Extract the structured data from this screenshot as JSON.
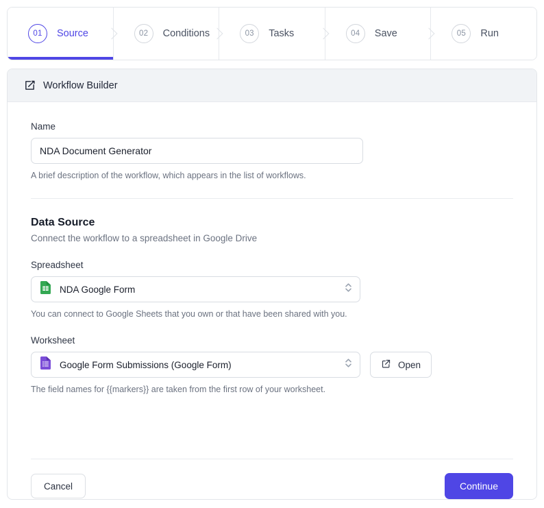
{
  "theme": {
    "accent": "#4f46e5",
    "header_bg": "#f1f3f6",
    "border": "#e3e6ea",
    "text": "#1f2536",
    "muted": "#6b7280",
    "sheets_green": "#34a853",
    "forms_purple": "#7248b9"
  },
  "stepper": {
    "steps": [
      {
        "number": "01",
        "label": "Source",
        "active": true
      },
      {
        "number": "02",
        "label": "Conditions",
        "active": false
      },
      {
        "number": "03",
        "label": "Tasks",
        "active": false
      },
      {
        "number": "04",
        "label": "Save",
        "active": false
      },
      {
        "number": "05",
        "label": "Run",
        "active": false
      }
    ]
  },
  "card": {
    "header": {
      "icon": "edit-square-icon",
      "title": "Workflow Builder"
    },
    "name_field": {
      "label": "Name",
      "value": "NDA Document Generator",
      "placeholder": "NDA Document Generator",
      "hint": "A brief description of the workflow, which appears in the list of workflows."
    },
    "data_source": {
      "title": "Data Source",
      "subtitle": "Connect the workflow to a spreadsheet in Google Drive",
      "spreadsheet": {
        "label": "Spreadsheet",
        "value": "NDA Google Form",
        "icon": "google-sheets-icon",
        "hint": "You can connect to Google Sheets that you own or that have been shared with you."
      },
      "worksheet": {
        "label": "Worksheet",
        "value": "Google Form Submissions (Google Form)",
        "icon": "google-forms-icon",
        "open_label": "Open",
        "open_icon": "external-link-icon",
        "hint": "The field names for {{markers}} are taken from the first row of your worksheet."
      }
    },
    "footer": {
      "cancel_label": "Cancel",
      "continue_label": "Continue"
    }
  }
}
